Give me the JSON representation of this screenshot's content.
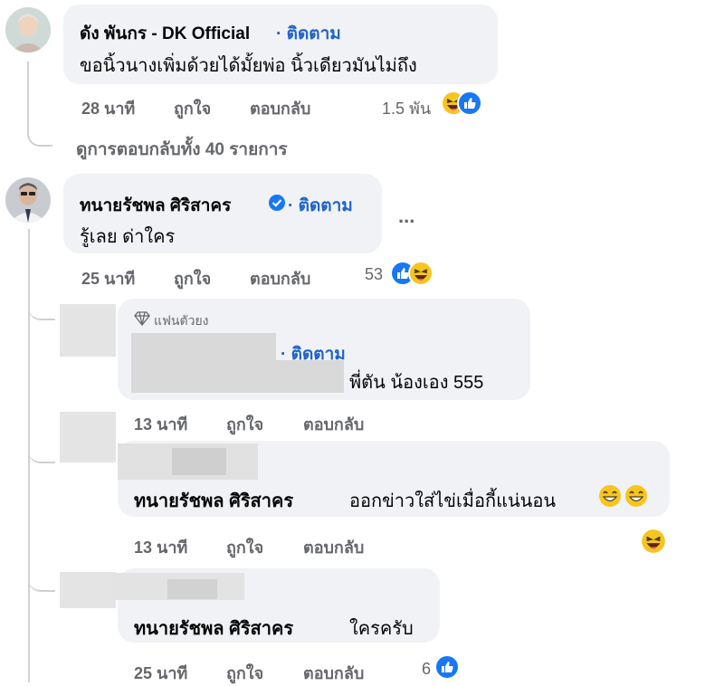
{
  "colors": {
    "accent": "#1f63c7",
    "meta": "#65676b",
    "bubble": "#f0f2f5",
    "like_blue": "#1877f2",
    "haha_yellow": "#f7c51f"
  },
  "comments": [
    {
      "author": "ดัง พันกร - DK Official",
      "follow": "· ติดตาม",
      "text": "ขอนิ้วนางเพิ่มด้วยได้มั้ยพ่อ นิ้วเดียวมันไม่ถึง",
      "time": "28 นาที",
      "like": "ถูกใจ",
      "reply": "ตอบกลับ",
      "reaction_count": "1.5 พัน",
      "view_replies": "ดูการตอบกลับทั้ง 40 รายการ"
    },
    {
      "author": "ทนายรัชพล ศิริสาคร",
      "follow": "· ติดตาม",
      "text": "รู้เลย ด่าใคร",
      "more": "...",
      "time": "25 นาที",
      "like": "ถูกใจ",
      "reply": "ตอบกลับ",
      "reaction_count": "53"
    }
  ],
  "replies": [
    {
      "badge": "แฟนตัวยง",
      "follow": "· ติดตาม",
      "text": "พี่ตัน น้องเอง 555",
      "time": "13 นาที",
      "like": "ถูกใจ",
      "reply": "ตอบกลับ"
    },
    {
      "author": "ทนายรัชพล ศิริสาคร",
      "text": "ออกข่าวใส่ไข่เมื่อกี้แน่นอน",
      "time": "13 นาที",
      "like": "ถูกใจ",
      "reply": "ตอบกลับ"
    },
    {
      "author": "ทนายรัชพล ศิริสาคร",
      "text": "ใครครับ",
      "time": "25 นาที",
      "like": "ถูกใจ",
      "reply": "ตอบกลับ",
      "reaction_count": "6"
    }
  ]
}
